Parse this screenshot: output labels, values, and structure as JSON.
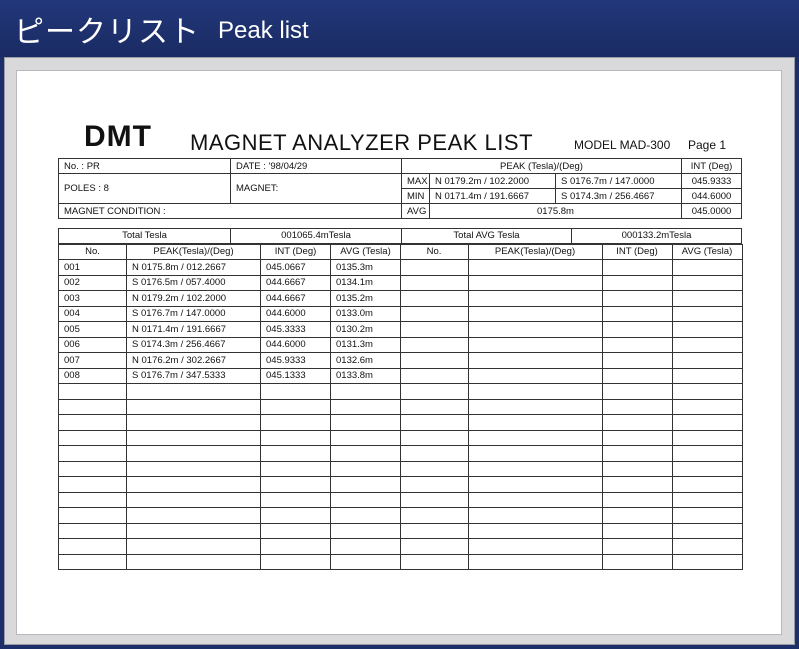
{
  "banner": {
    "title_jp": "ピークリスト",
    "title_en": "Peak list"
  },
  "doc": {
    "brand": "DMT",
    "title": "MAGNET ANALYZER PEAK LIST",
    "model": "MODEL MAD-300",
    "page": "Page  1"
  },
  "info": {
    "no": "No.  :  PR",
    "date": "DATE  :  '98/04/29",
    "poles": "POLES :  8",
    "magnet": "MAGNET:",
    "condition": "MAGNET CONDITION :",
    "peak_header": "PEAK (Tesla)/(Deg)",
    "int_header": "INT (Deg)",
    "max_label": "MAX",
    "max_n": "N 0179.2m  /  102.2000",
    "max_s": "S 0176.7m  /  147.0000",
    "max_int": "045.9333",
    "min_label": "MIN",
    "min_n": "N 0171.4m  /  191.6667",
    "min_s": "S 0174.3m  /  256.4667",
    "min_int": "044.6000",
    "avg_label": "AVG",
    "avg_val": "0175.8m",
    "avg_int": "045.0000"
  },
  "totals": {
    "total_label": "Total Tesla",
    "total_value": "001065.4mTesla",
    "total_avg_label": "Total AVG Tesla",
    "total_avg_value": "000133.2mTesla"
  },
  "columns": {
    "no": "No.",
    "peak": "PEAK(Tesla)/(Deg)",
    "int": "INT (Deg)",
    "avg": "AVG (Tesla)"
  },
  "rows": [
    [
      "001",
      "N 0175.8m  /  012.2667",
      "045.0667",
      "0135.3m"
    ],
    [
      "002",
      "S 0176.5m  /  057.4000",
      "044.6667",
      "0134.1m"
    ],
    [
      "003",
      "N 0179.2m  /  102.2000",
      "044.6667",
      "0135.2m"
    ],
    [
      "004",
      "S 0176.7m  /  147.0000",
      "044.6000",
      "0133.0m"
    ],
    [
      "005",
      "N 0171.4m  /  191.6667",
      "045.3333",
      "0130.2m"
    ],
    [
      "006",
      "S 0174.3m  /  256.4667",
      "044.6000",
      "0131.3m"
    ],
    [
      "007",
      "N 0176.2m  /  302.2667",
      "045.9333",
      "0132.6m"
    ],
    [
      "008",
      "S 0176.7m  /  347.5333",
      "045.1333",
      "0133.8m"
    ]
  ]
}
